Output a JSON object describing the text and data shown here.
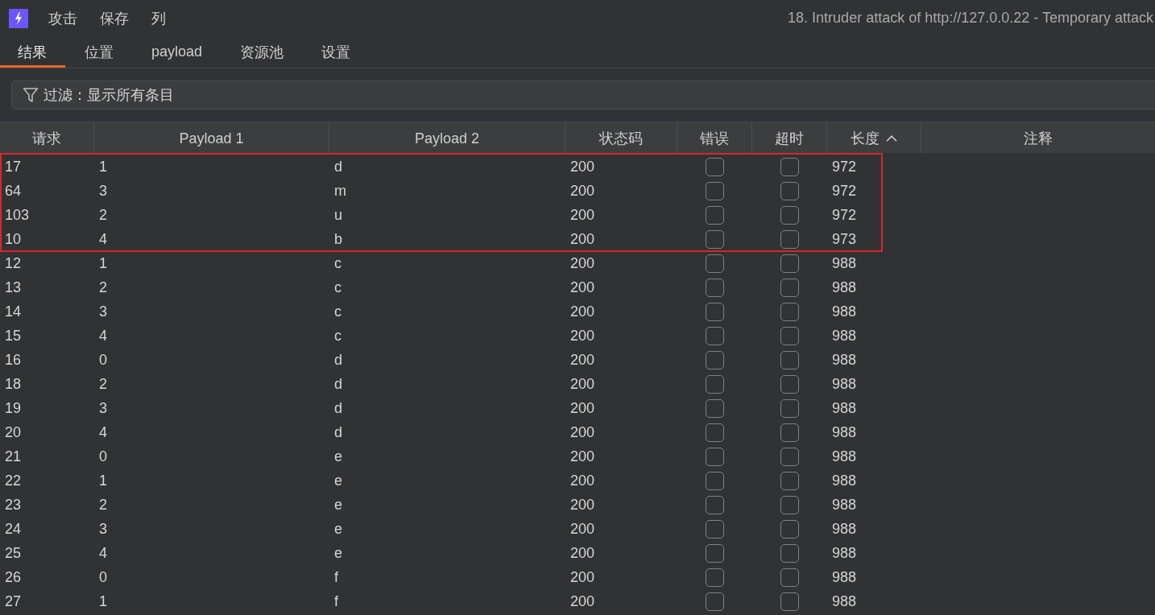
{
  "menu": [
    {
      "label": "攻击"
    },
    {
      "label": "保存"
    },
    {
      "label": "列"
    }
  ],
  "window": {
    "title": "18. Intruder attack of http://127.0.0.22 - Temporary attack"
  },
  "tabs": [
    {
      "label": "结果",
      "selected": true
    },
    {
      "label": "位置",
      "selected": false
    },
    {
      "label": "payload",
      "selected": false
    },
    {
      "label": "资源池",
      "selected": false
    },
    {
      "label": "设置",
      "selected": false
    }
  ],
  "filter": {
    "label": "过滤：显示所有条目"
  },
  "table": {
    "columns": [
      {
        "label": "请求",
        "kind": "text",
        "sorted": false
      },
      {
        "label": "Payload 1",
        "kind": "text",
        "sorted": false
      },
      {
        "label": "Payload 2",
        "kind": "text",
        "sorted": false
      },
      {
        "label": "状态码",
        "kind": "text",
        "sorted": false
      },
      {
        "label": "错误",
        "kind": "checkbox",
        "sorted": false
      },
      {
        "label": "超时",
        "kind": "checkbox",
        "sorted": false
      },
      {
        "label": "长度",
        "kind": "text",
        "sorted": true
      },
      {
        "label": "注释",
        "kind": "text",
        "sorted": false
      }
    ],
    "rows": [
      {
        "request": "17",
        "payload_1": "1",
        "payload_2": "d",
        "status": "200",
        "error": false,
        "timeout": false,
        "length": "972",
        "highlighted": true
      },
      {
        "request": "64",
        "payload_1": "3",
        "payload_2": "m",
        "status": "200",
        "error": false,
        "timeout": false,
        "length": "972",
        "highlighted": true
      },
      {
        "request": "103",
        "payload_1": "2",
        "payload_2": "u",
        "status": "200",
        "error": false,
        "timeout": false,
        "length": "972",
        "highlighted": true
      },
      {
        "request": "10",
        "payload_1": "4",
        "payload_2": "b",
        "status": "200",
        "error": false,
        "timeout": false,
        "length": "973",
        "highlighted": true
      },
      {
        "request": "12",
        "payload_1": "1",
        "payload_2": "c",
        "status": "200",
        "error": false,
        "timeout": false,
        "length": "988",
        "highlighted": false
      },
      {
        "request": "13",
        "payload_1": "2",
        "payload_2": "c",
        "status": "200",
        "error": false,
        "timeout": false,
        "length": "988",
        "highlighted": false
      },
      {
        "request": "14",
        "payload_1": "3",
        "payload_2": "c",
        "status": "200",
        "error": false,
        "timeout": false,
        "length": "988",
        "highlighted": false
      },
      {
        "request": "15",
        "payload_1": "4",
        "payload_2": "c",
        "status": "200",
        "error": false,
        "timeout": false,
        "length": "988",
        "highlighted": false
      },
      {
        "request": "16",
        "payload_1": "0",
        "payload_2": "d",
        "status": "200",
        "error": false,
        "timeout": false,
        "length": "988",
        "highlighted": false
      },
      {
        "request": "18",
        "payload_1": "2",
        "payload_2": "d",
        "status": "200",
        "error": false,
        "timeout": false,
        "length": "988",
        "highlighted": false
      },
      {
        "request": "19",
        "payload_1": "3",
        "payload_2": "d",
        "status": "200",
        "error": false,
        "timeout": false,
        "length": "988",
        "highlighted": false
      },
      {
        "request": "20",
        "payload_1": "4",
        "payload_2": "d",
        "status": "200",
        "error": false,
        "timeout": false,
        "length": "988",
        "highlighted": false
      },
      {
        "request": "21",
        "payload_1": "0",
        "payload_2": "e",
        "status": "200",
        "error": false,
        "timeout": false,
        "length": "988",
        "highlighted": false
      },
      {
        "request": "22",
        "payload_1": "1",
        "payload_2": "e",
        "status": "200",
        "error": false,
        "timeout": false,
        "length": "988",
        "highlighted": false
      },
      {
        "request": "23",
        "payload_1": "2",
        "payload_2": "e",
        "status": "200",
        "error": false,
        "timeout": false,
        "length": "988",
        "highlighted": false
      },
      {
        "request": "24",
        "payload_1": "3",
        "payload_2": "e",
        "status": "200",
        "error": false,
        "timeout": false,
        "length": "988",
        "highlighted": false
      },
      {
        "request": "25",
        "payload_1": "4",
        "payload_2": "e",
        "status": "200",
        "error": false,
        "timeout": false,
        "length": "988",
        "highlighted": false
      },
      {
        "request": "26",
        "payload_1": "0",
        "payload_2": "f",
        "status": "200",
        "error": false,
        "timeout": false,
        "length": "988",
        "highlighted": false
      },
      {
        "request": "27",
        "payload_1": "1",
        "payload_2": "f",
        "status": "200",
        "error": false,
        "timeout": false,
        "length": "988",
        "highlighted": false
      }
    ]
  }
}
